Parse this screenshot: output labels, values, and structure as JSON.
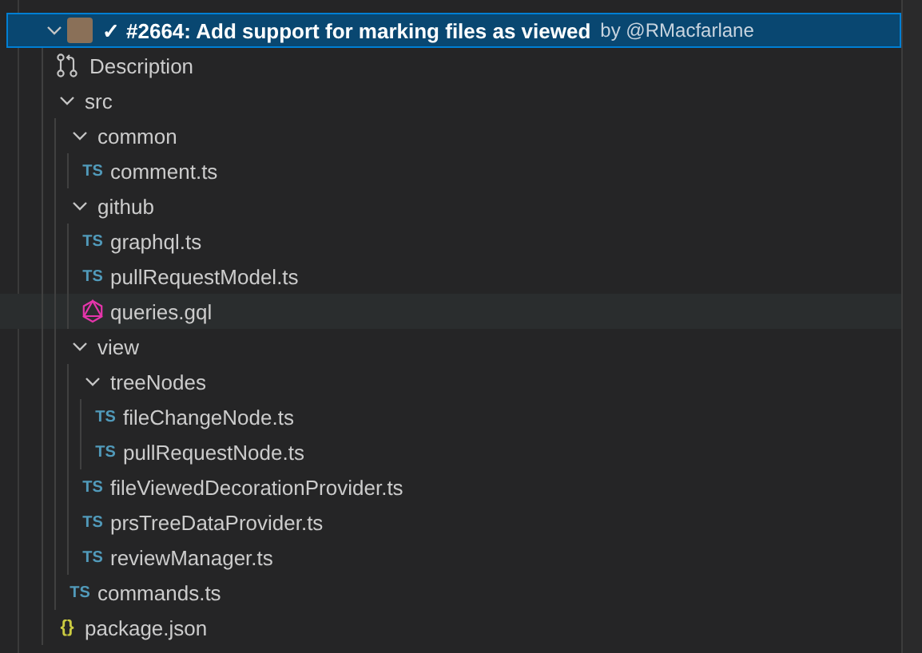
{
  "tree": [
    {
      "kind": "pull-request",
      "status": "✓",
      "title": "#2664: Add support for marking files as viewed",
      "author": "by @RMacfarlane",
      "expanded": true,
      "selected": true,
      "hovered": false,
      "children": [
        {
          "kind": "description",
          "label": "Description",
          "selected": false,
          "hovered": false
        },
        {
          "kind": "folder",
          "label": "src",
          "expanded": true,
          "selected": false,
          "hovered": false,
          "children": [
            {
              "kind": "folder",
              "label": "common",
              "expanded": true,
              "selected": false,
              "hovered": false,
              "children": [
                {
                  "kind": "ts",
                  "icon_text": "TS",
                  "label": "comment.ts",
                  "selected": false,
                  "hovered": false
                }
              ]
            },
            {
              "kind": "folder",
              "label": "github",
              "expanded": true,
              "selected": false,
              "hovered": false,
              "children": [
                {
                  "kind": "ts",
                  "icon_text": "TS",
                  "label": "graphql.ts",
                  "selected": false,
                  "hovered": false
                },
                {
                  "kind": "ts",
                  "icon_text": "TS",
                  "label": "pullRequestModel.ts",
                  "selected": false,
                  "hovered": false
                },
                {
                  "kind": "gql",
                  "label": "queries.gql",
                  "selected": false,
                  "hovered": true
                }
              ]
            },
            {
              "kind": "folder",
              "label": "view",
              "expanded": true,
              "selected": false,
              "hovered": false,
              "children": [
                {
                  "kind": "folder",
                  "label": "treeNodes",
                  "expanded": true,
                  "selected": false,
                  "hovered": false,
                  "children": [
                    {
                      "kind": "ts",
                      "icon_text": "TS",
                      "label": "fileChangeNode.ts",
                      "selected": false,
                      "hovered": false
                    },
                    {
                      "kind": "ts",
                      "icon_text": "TS",
                      "label": "pullRequestNode.ts",
                      "selected": false,
                      "hovered": false
                    }
                  ]
                },
                {
                  "kind": "ts",
                  "icon_text": "TS",
                  "label": "fileViewedDecorationProvider.ts",
                  "selected": false,
                  "hovered": false
                },
                {
                  "kind": "ts",
                  "icon_text": "TS",
                  "label": "prsTreeDataProvider.ts",
                  "selected": false,
                  "hovered": false
                },
                {
                  "kind": "ts",
                  "icon_text": "TS",
                  "label": "reviewManager.ts",
                  "selected": false,
                  "hovered": false
                }
              ]
            },
            {
              "kind": "ts",
              "icon_text": "TS",
              "label": "commands.ts",
              "selected": false,
              "hovered": false
            }
          ]
        },
        {
          "kind": "json",
          "icon_text": "{}",
          "label": "package.json",
          "selected": false,
          "hovered": false
        }
      ]
    }
  ]
}
